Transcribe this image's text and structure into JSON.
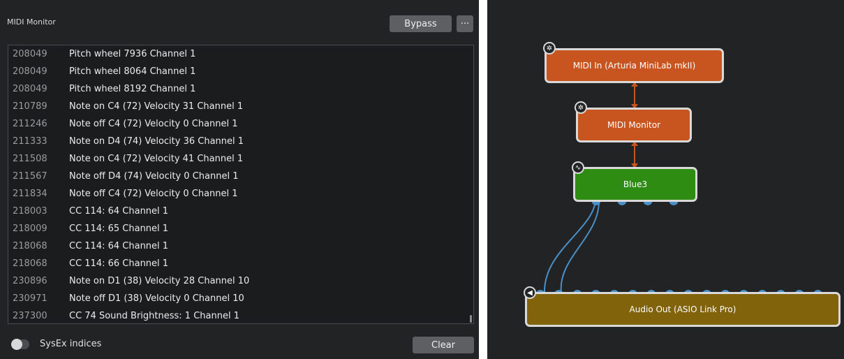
{
  "monitor": {
    "title": "MIDI Monitor",
    "bypass_label": "Bypass",
    "more_label": "···",
    "events": [
      {
        "ts": "208049",
        "msg": "Pitch wheel 7936 Channel 1"
      },
      {
        "ts": "208049",
        "msg": "Pitch wheel 8064 Channel 1"
      },
      {
        "ts": "208049",
        "msg": "Pitch wheel 8192 Channel 1"
      },
      {
        "ts": "210789",
        "msg": "Note on C4 (72) Velocity 31 Channel 1"
      },
      {
        "ts": "211246",
        "msg": "Note off C4 (72) Velocity 0 Channel 1"
      },
      {
        "ts": "211333",
        "msg": "Note on D4 (74) Velocity 36 Channel 1"
      },
      {
        "ts": "211508",
        "msg": "Note on C4 (72) Velocity 41 Channel 1"
      },
      {
        "ts": "211567",
        "msg": "Note off D4 (74) Velocity 0 Channel 1"
      },
      {
        "ts": "211834",
        "msg": "Note off C4 (72) Velocity 0 Channel 1"
      },
      {
        "ts": "218003",
        "msg": "CC 114: 64 Channel 1"
      },
      {
        "ts": "218009",
        "msg": "CC 114: 65 Channel 1"
      },
      {
        "ts": "218068",
        "msg": "CC 114: 64 Channel 1"
      },
      {
        "ts": "218068",
        "msg": "CC 114: 66 Channel 1"
      },
      {
        "ts": "230896",
        "msg": "Note on D1 (38) Velocity 28 Channel 10"
      },
      {
        "ts": "230971",
        "msg": "Note off D1 (38) Velocity 0 Channel 10"
      },
      {
        "ts": "237300",
        "msg": "CC 74 Sound Brightness: 1 Channel 1"
      }
    ],
    "sysex_label": "SysEx indices",
    "sysex_enabled": false,
    "clear_label": "Clear"
  },
  "graph": {
    "nodes": {
      "midi_in": {
        "label": "MIDI In (Arturia MiniLab mkII)",
        "icon": "midi-port-icon"
      },
      "midi_monitor": {
        "label": "MIDI Monitor",
        "icon": "midi-port-icon"
      },
      "blue3": {
        "label": "Blue3",
        "icon": "waveform-icon"
      },
      "audio_out": {
        "label": "Audio Out (ASIO Link Pro)",
        "icon": "speaker-icon"
      }
    }
  },
  "colors": {
    "background": "#222325",
    "midi_node": "#c8541f",
    "instrument_node": "#2f8c12",
    "audio_node": "#80630a",
    "midi_connection": "#c8541f",
    "audio_connection": "#4a90c8"
  }
}
